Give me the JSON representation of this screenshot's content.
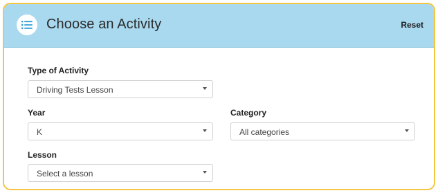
{
  "header": {
    "icon": "list-icon",
    "title": "Choose an Activity",
    "reset_label": "Reset"
  },
  "form": {
    "type_of_activity": {
      "label": "Type of Activity",
      "value": "Driving Tests Lesson"
    },
    "year": {
      "label": "Year",
      "value": "K"
    },
    "category": {
      "label": "Category",
      "value": "All categories"
    },
    "lesson": {
      "label": "Lesson",
      "value": "Select a lesson"
    }
  },
  "colors": {
    "header_bg": "#a8d9ef",
    "panel_border": "#f6c542"
  }
}
